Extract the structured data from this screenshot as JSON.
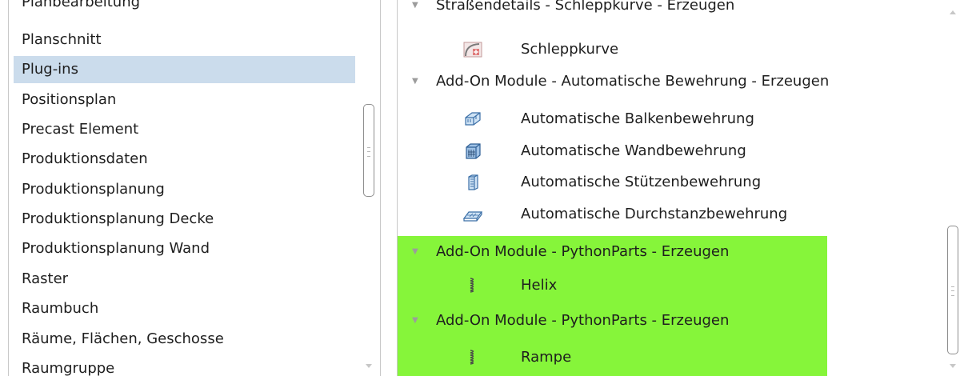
{
  "left_list": {
    "items": [
      {
        "label": "Planbearbeitung",
        "selected": false
      },
      {
        "label": "Planschnitt",
        "selected": false
      },
      {
        "label": "Plug-ins",
        "selected": true
      },
      {
        "label": "Positionsplan",
        "selected": false
      },
      {
        "label": "Precast Element",
        "selected": false
      },
      {
        "label": "Produktionsdaten",
        "selected": false
      },
      {
        "label": "Produktionsplanung",
        "selected": false
      },
      {
        "label": "Produktionsplanung Decke",
        "selected": false
      },
      {
        "label": "Produktionsplanung Wand",
        "selected": false
      },
      {
        "label": "Raster",
        "selected": false
      },
      {
        "label": "Raumbuch",
        "selected": false
      },
      {
        "label": "Räume, Flächen, Geschosse",
        "selected": false
      },
      {
        "label": "Raumgruppe",
        "selected": false
      }
    ]
  },
  "right_tree": {
    "rows": [
      {
        "type": "group",
        "label": "Straßendetails - Schleppkurve - Erzeugen",
        "icon": "chevron-down-icon"
      },
      {
        "type": "child",
        "label": "Schleppkurve",
        "icon": "schleppkurve-icon"
      },
      {
        "type": "group",
        "label": "Add-On Module - Automatische Bewehrung - Erzeugen",
        "icon": "chevron-down-icon"
      },
      {
        "type": "child",
        "label": "Automatische Balkenbewehrung",
        "icon": "beam-reinforcement-icon"
      },
      {
        "type": "child",
        "label": "Automatische Wandbewehrung",
        "icon": "wall-reinforcement-icon"
      },
      {
        "type": "child",
        "label": "Automatische Stützenbewehrung",
        "icon": "column-reinforcement-icon"
      },
      {
        "type": "child",
        "label": "Automatische Durchstanzbewehrung",
        "icon": "punching-reinforcement-icon"
      },
      {
        "type": "group",
        "label": "Add-On Module - PythonParts - Erzeugen",
        "icon": "chevron-down-icon",
        "highlight": true
      },
      {
        "type": "child",
        "label": "Helix",
        "icon": "helix-icon",
        "highlight": true
      },
      {
        "type": "group",
        "label": "Add-On Module - PythonParts - Erzeugen",
        "icon": "chevron-down-icon",
        "highlight": true
      },
      {
        "type": "child",
        "label": "Rampe",
        "icon": "ramp-icon",
        "highlight": true
      }
    ]
  },
  "colors": {
    "selection": "#cbdcec",
    "highlight": "#86f53a",
    "border": "#c8c8c8"
  }
}
